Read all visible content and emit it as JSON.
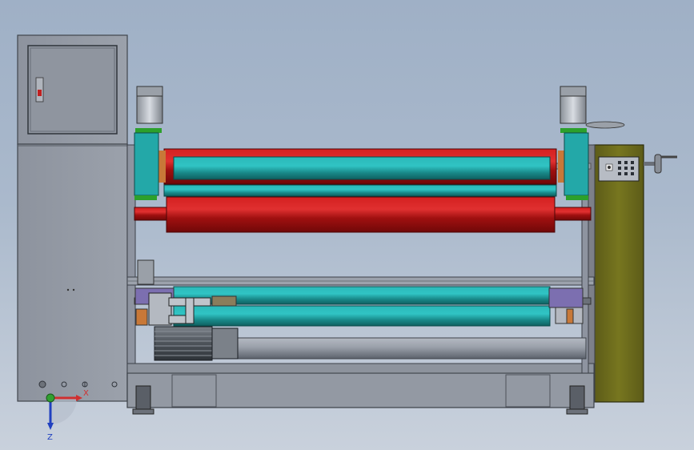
{
  "scene": {
    "model": "roller-coating-machine-front-view",
    "background_top": "#9fb0c6",
    "background_bottom": "#c9d1dc"
  },
  "colors": {
    "frame": "#8e94a0",
    "frame_dark": "#5d636e",
    "cabinet": "#8a909b",
    "red_roller": "#b01818",
    "teal_roller": "#1f9e9e",
    "olive_panel": "#6b6a1e",
    "motor": "#5a6068",
    "axis_x": "#d03030",
    "axis_y": "#30a030",
    "axis_z": "#2040c0"
  },
  "triad": {
    "x_label": "X",
    "z_label": "Z"
  }
}
